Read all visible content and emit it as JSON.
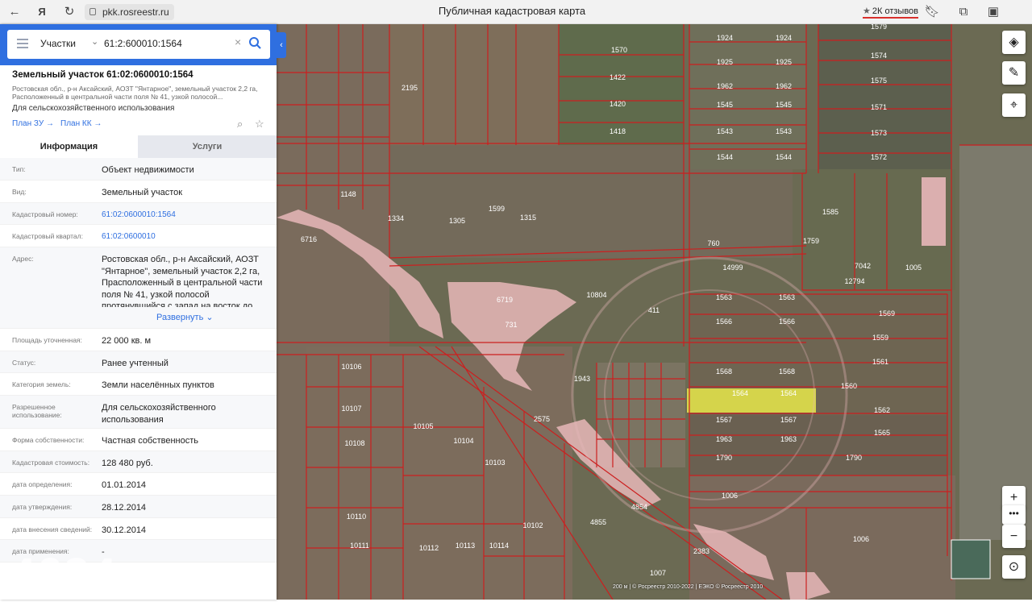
{
  "browser": {
    "url": "pkk.rosreestr.ru",
    "page_title": "Публичная кадастровая карта",
    "reviews": "2К отзывов"
  },
  "search": {
    "type": "Участки",
    "query": "61:2:600010:1564"
  },
  "object": {
    "title": "Земельный участок 61:02:0600010:1564",
    "address_short": "Ростовская обл., р-н Аксайский, АОЗТ \"Янтарное\", земельный участок 2,2 га, Расположенный в центральной части поля № 41, узкой полосой...",
    "purpose": "Для сельскохозяйственного использования",
    "plan_zu": "План ЗУ →",
    "plan_kk": "План КК →"
  },
  "tabs": [
    "Информация",
    "Услуги"
  ],
  "info": {
    "type_label": "Тип:",
    "type_value": "Объект недвижимости",
    "kind_label": "Вид:",
    "kind_value": "Земельный участок",
    "cadnum_label": "Кадастровый номер:",
    "cadnum_value": "61:02:0600010:1564",
    "quarter_label": "Кадастровый квартал:",
    "quarter_value": "61:02:0600010",
    "address_label": "Адрес:",
    "address_value": "Ростовская обл., р-н Аксайский, АОЗТ \"Янтарное\", земельный участок 2,2 га, Прасположенный в центральной части поля № 41, узкой полосой протянувшийся с запад на восток до",
    "expand": "Развернуть",
    "area_label": "Площадь уточненная:",
    "area_value": "22 000 кв. м",
    "status_label": "Статус:",
    "status_value": "Ранее учтенный",
    "category_label": "Категория земель:",
    "category_value": "Земли населённых пунктов",
    "permitted_label": "Разрешенное использование:",
    "permitted_value": "Для сельскохозяйственного использования",
    "ownership_label": "Форма собственности:",
    "ownership_value": "Частная собственность",
    "cost_label": "Кадастровая стоимость:",
    "cost_value": "128 480 руб.",
    "def_date_label": "дата определения:",
    "def_date_value": "01.01.2014",
    "appr_date_label": "дата утверждения:",
    "appr_date_value": "28.12.2014",
    "entry_date_label": "дата внесения сведений:",
    "entry_date_value": "30.12.2014",
    "apply_date_label": "дата применения:",
    "apply_date_value": "-"
  },
  "watermark": "4624",
  "map_labels": [
    "1564",
    "1564",
    "1563",
    "1563",
    "1566",
    "1566",
    "1568",
    "1568",
    "1567",
    "1567",
    "1963",
    "1963",
    "1790",
    "1790",
    "1565",
    "1562",
    "1560",
    "1561",
    "1559",
    "1569",
    "1006",
    "1006",
    "1924",
    "1924",
    "1925",
    "1925",
    "1962",
    "1962",
    "1545",
    "1545",
    "1543",
    "1543",
    "1544",
    "1544",
    "1570",
    "1422",
    "1420",
    "1418",
    "1579",
    "1574",
    "1575",
    "1571",
    "1573",
    "1572",
    "2195",
    "1585",
    "1005",
    "7042",
    "12794",
    "6716",
    "6719",
    "10804",
    "1148",
    "1334",
    "1305",
    "1599",
    "1315",
    "1759",
    "760",
    "14999",
    "411",
    "731",
    "1943",
    "2575",
    "10107",
    "10108",
    "10106",
    "10105",
    "10104",
    "10103",
    "10102",
    "10110",
    "10111",
    "10112",
    "10113",
    "10114",
    "4855",
    "4854",
    "2383",
    "1007"
  ],
  "attribution": "200 м | © Росреестр 2010-2022 | ЕЭКО © Росреестр 2010"
}
